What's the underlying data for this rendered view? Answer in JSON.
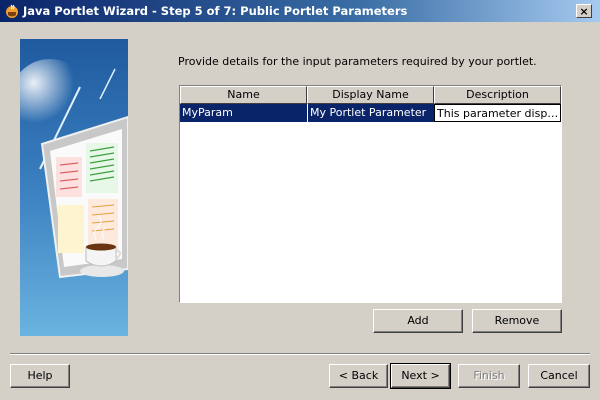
{
  "window": {
    "title": "Java Portlet Wizard - Step 5 of 7: Public Portlet Parameters",
    "close_label": "×"
  },
  "main": {
    "instruction": "Provide details for the input parameters required by your portlet.",
    "table": {
      "headers": [
        "Name",
        "Display Name",
        "Description"
      ],
      "rows": [
        [
          "MyParam",
          "My Portlet Parameter",
          "This parameter display..."
        ]
      ]
    },
    "add_label": "Add",
    "remove_label": "Remove"
  },
  "footer": {
    "help_label": "Help",
    "back_label": "< Back",
    "next_label": "Next >",
    "finish_label": "Finish",
    "cancel_label": "Cancel"
  },
  "colors": {
    "selection": "#0a246a",
    "face": "#d4d0c8"
  }
}
